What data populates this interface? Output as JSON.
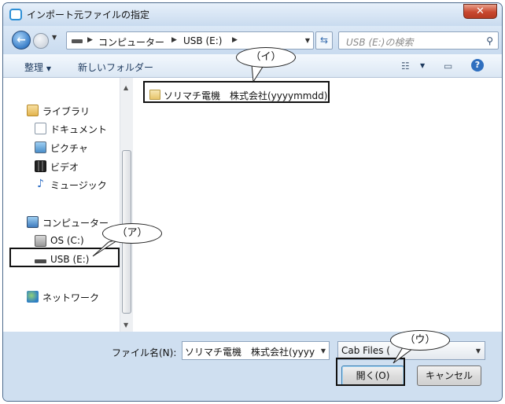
{
  "window": {
    "title": "インポート元ファイルの指定",
    "close_label": "✕"
  },
  "navbar": {
    "back_icon": "back-arrow-icon",
    "breadcrumbs": [
      "コンピューター",
      "USB (E:)"
    ],
    "search_placeholder": "USB (E:)の検索"
  },
  "toolbar": {
    "organize_label": "整理",
    "new_folder_label": "新しいフォルダー"
  },
  "sidebar": {
    "libraries_label": "ライブラリ",
    "library_items": [
      {
        "label": "ドキュメント",
        "icon": "document-icon"
      },
      {
        "label": "ピクチャ",
        "icon": "picture-icon"
      },
      {
        "label": "ビデオ",
        "icon": "video-icon"
      },
      {
        "label": "ミュージック",
        "icon": "music-icon"
      }
    ],
    "computer_label": "コンピューター",
    "drives": [
      {
        "label": "OS (C:)",
        "icon": "hard-drive-icon"
      },
      {
        "label": "USB (E:)",
        "icon": "usb-drive-icon",
        "selected": true
      }
    ],
    "network_label": "ネットワーク"
  },
  "files": [
    {
      "name": "ソリマチ電機　株式会社(yyyymmdd)",
      "icon": "folder-icon"
    }
  ],
  "footer": {
    "filename_label": "ファイル名(N):",
    "filename_value": "ソリマチ電機　株式会社(yyyy",
    "filetype_value": "Cab Files (",
    "open_label": "開く(O)",
    "cancel_label": "キャンセル"
  },
  "annotations": {
    "a": "（ア）",
    "i": "（イ）",
    "u": "（ウ）"
  },
  "colors": {
    "frame": "#cfdff0",
    "title_gradient_top": "#e7f0fa",
    "close_red": "#c8472f",
    "toolbar_text": "#1e3a5e",
    "highlight_border": "#111111"
  }
}
